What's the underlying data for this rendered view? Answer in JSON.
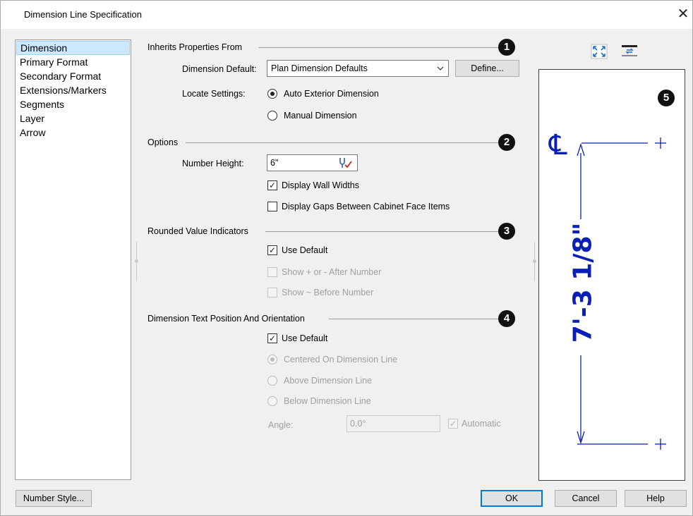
{
  "window": {
    "title": "Dimension Line Specification",
    "close_glyph": "✕"
  },
  "nav": {
    "items": [
      "Dimension",
      "Primary Format",
      "Secondary Format",
      "Extensions/Markers",
      "Segments",
      "Layer",
      "Arrow"
    ],
    "selected": "Dimension"
  },
  "inherits": {
    "title": "Inherits Properties From",
    "badge": "1",
    "dimension_default_label": "Dimension Default:",
    "dimension_default_value": "Plan Dimension Defaults",
    "define_button": "Define...",
    "locate_label": "Locate Settings:",
    "locate_auto": "Auto Exterior Dimension",
    "locate_manual": "Manual Dimension"
  },
  "options": {
    "title": "Options",
    "badge": "2",
    "number_height_label": "Number Height:",
    "number_height_value": "6\"",
    "display_wall_widths": "Display Wall Widths",
    "display_gaps": "Display Gaps Between Cabinet Face Items"
  },
  "rounded": {
    "title": "Rounded Value Indicators",
    "badge": "3",
    "use_default": "Use Default",
    "show_plus_minus": "Show + or - After Number",
    "show_tilde": "Show ~ Before Number"
  },
  "text_position": {
    "title": "Dimension Text Position And Orientation",
    "badge": "4",
    "use_default": "Use Default",
    "centered": "Centered On Dimension Line",
    "above": "Above Dimension Line",
    "below": "Below Dimension Line",
    "angle_label": "Angle:",
    "angle_value": "0.0°",
    "automatic": "Automatic"
  },
  "preview": {
    "badge": "5",
    "dimension_text": "7'-3 1/8\"",
    "centerline_symbol": "℄",
    "ink_color": "#0a1fb5",
    "icons": [
      "fill-window-icon",
      "swap-sides-icon"
    ]
  },
  "buttons": {
    "number_style": "Number Style...",
    "ok": "OK",
    "cancel": "Cancel",
    "help": "Help"
  }
}
